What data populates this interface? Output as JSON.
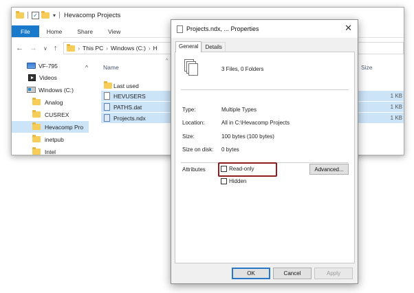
{
  "explorer": {
    "title": "Hevacomp Projects",
    "ribbon_tabs": [
      "File",
      "Home",
      "Share",
      "View"
    ],
    "breadcrumb": [
      "This PC",
      "Windows (C:)",
      "H"
    ],
    "nav_items": [
      {
        "label": "VF-795",
        "icon": "network-drive-icon"
      },
      {
        "label": "Videos",
        "icon": "videos-icon"
      },
      {
        "label": "Windows (C:)",
        "icon": "windows-drive-icon"
      },
      {
        "label": "Analog",
        "icon": "folder-icon"
      },
      {
        "label": "CUSREX",
        "icon": "folder-icon"
      },
      {
        "label": "Hevacomp Pro",
        "icon": "folder-icon"
      },
      {
        "label": "inetpub",
        "icon": "folder-icon"
      },
      {
        "label": "Intel",
        "icon": "folder-icon"
      }
    ],
    "columns": {
      "name": "Name",
      "size": "Size"
    },
    "files": [
      {
        "name": "Last used",
        "size": "",
        "icon": "folder-icon"
      },
      {
        "name": "HEVUSERS",
        "size": "1 KB",
        "icon": "document-icon"
      },
      {
        "name": "PATHS.dat",
        "size": "1 KB",
        "icon": "dat-file-icon"
      },
      {
        "name": "Projects.ndx",
        "size": "1 KB",
        "icon": "ndx-file-icon"
      }
    ]
  },
  "dialog": {
    "title": "Projects.ndx, ... Properties",
    "tabs": [
      "General",
      "Details"
    ],
    "summary": "3 Files, 0 Folders",
    "type_label": "Type:",
    "type_value": "Multiple Types",
    "location_label": "Location:",
    "location_value": "All in C:\\Hevacomp Projects",
    "size_label": "Size:",
    "size_value": "100 bytes (100 bytes)",
    "size_on_disk_label": "Size on disk:",
    "size_on_disk_value": "0 bytes",
    "attributes_label": "Attributes",
    "readonly_label": "Read-only",
    "hidden_label": "Hidden",
    "advanced_label": "Advanced...",
    "ok_label": "OK",
    "cancel_label": "Cancel",
    "apply_label": "Apply"
  },
  "colors": {
    "accent": "#1979ca",
    "selection": "#cce4f7",
    "highlight_box": "#8e1c1c"
  }
}
